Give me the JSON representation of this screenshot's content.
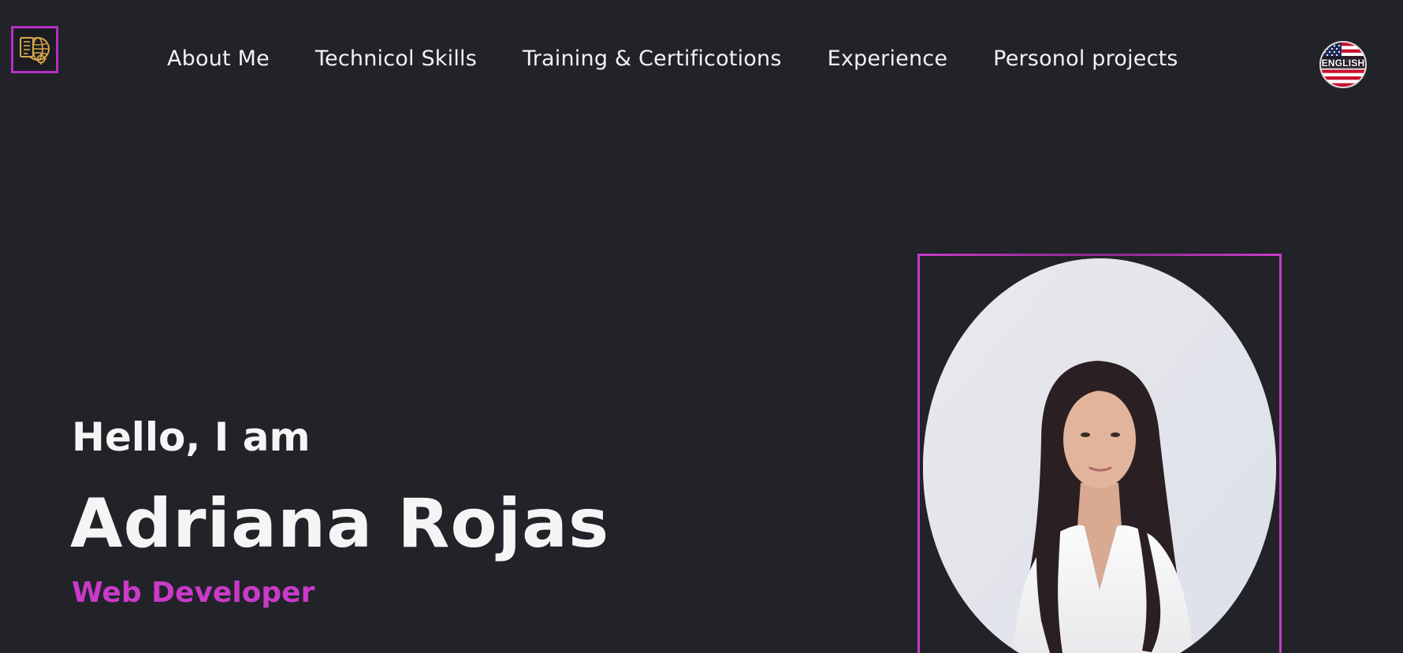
{
  "header": {
    "nav": [
      {
        "label": "About Me"
      },
      {
        "label": "Technicol Skills"
      },
      {
        "label": "Training & Certificotions"
      },
      {
        "label": "Experience"
      },
      {
        "label": "Personol projects"
      }
    ],
    "language": {
      "label": "ENGLISH",
      "icon": "us-flag-icon"
    },
    "logo_icon": "globe-document-icon"
  },
  "hero": {
    "greeting": "Hello, I am",
    "name": "Adriana Rojas",
    "role": "Web Developer"
  },
  "colors": {
    "background": "#212329",
    "accent": "#c93ac8",
    "text": "#f5f5f5"
  }
}
